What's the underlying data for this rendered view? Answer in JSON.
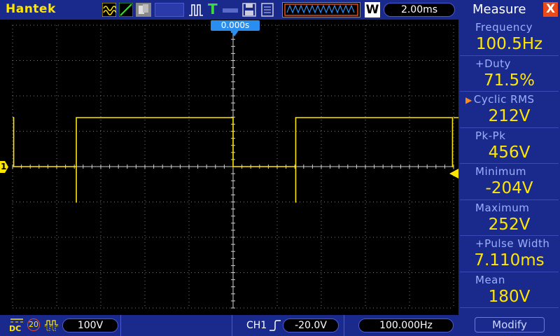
{
  "header": {
    "brand": "Hantek",
    "timebase": "2.00ms",
    "icons": [
      "waveform-icon",
      "ramp-icon",
      "persistence-icon",
      "pulse-icon",
      "trigger-t-icon",
      "save-icon",
      "print-icon",
      "memory-depth-icon",
      "w-icon"
    ],
    "w_label": "W",
    "trigger_letter": "T"
  },
  "screen": {
    "trigger_position_label": "0.000s",
    "channel_marker": "1",
    "trace_color": "#ffe600",
    "grid_divisions": {
      "horizontal": 10,
      "vertical": 8
    }
  },
  "measure_menu": {
    "title": "Measure",
    "close_label": "X",
    "items": [
      {
        "label": "Frequency",
        "value": "100.5Hz"
      },
      {
        "label": "+Duty",
        "value": "71.5%"
      },
      {
        "label": "Cyclic RMS",
        "value": "212V",
        "selected": true
      },
      {
        "label": "Pk-Pk",
        "value": "456V"
      },
      {
        "label": "Minimum",
        "value": "-204V"
      },
      {
        "label": "Maximum",
        "value": "252V"
      },
      {
        "label": "+Pulse Width",
        "value": "7.110ms"
      },
      {
        "label": "Mean",
        "value": "180V"
      }
    ],
    "modify_label": "Modify"
  },
  "footer": {
    "coupling": "DC",
    "bandwidth_limit": "20",
    "volts_per_div": "100V",
    "trigger_channel": "CH1",
    "trigger_level": "-20.0V",
    "trigger_frequency": "100.000Hz"
  },
  "colors": {
    "panel_blue": "#1a2a8c",
    "accent_yellow": "#ffe600",
    "label_blue": "#9ab0ff",
    "close_red": "#e84a1a",
    "trigger_blue": "#2a8ef0"
  }
}
